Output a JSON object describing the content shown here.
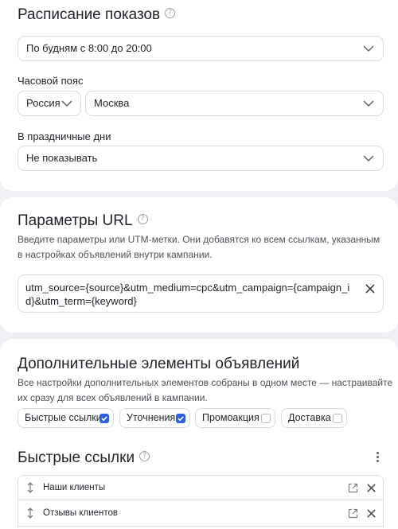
{
  "schedule": {
    "title": "Расписание показов",
    "value": "По будням с 8:00 до 20:00",
    "timezone_label": "Часовой пояс",
    "country": "Россия",
    "city": "Москва",
    "holidays_label": "В праздничные дни",
    "holidays_value": "Не показывать"
  },
  "url_params": {
    "title": "Параметры URL",
    "desc_line1": "Введите параметры или UTM-метки. Они добавятся ко всем ссылкам, указанным",
    "desc_line2": "в настройках объявлений внутри кампании.",
    "value": "utm_source={source}&utm_medium=cpc&utm_campaign={campaign_id}&utm_term={keyword}"
  },
  "extras": {
    "title": "Дополнительные элементы объявлений",
    "desc_line1": "Все настройки дополнительных элементов собраны в одном месте — настраивайте",
    "desc_line2": "их сразу для всех объявлений в кампании.",
    "chips": [
      {
        "label": "Быстрые ссылки",
        "checked": true
      },
      {
        "label": "Уточнения",
        "checked": true
      },
      {
        "label": "Промоакция",
        "checked": false
      },
      {
        "label": "Доставка",
        "checked": false
      }
    ]
  },
  "quick_links": {
    "title": "Быстрые ссылки",
    "items": [
      "Наши клиенты",
      "Отзывы клиентов"
    ]
  },
  "colors": {
    "accent": "#2f5fe0",
    "page_bg": "#eef0f5",
    "border": "#d8dbe0"
  }
}
